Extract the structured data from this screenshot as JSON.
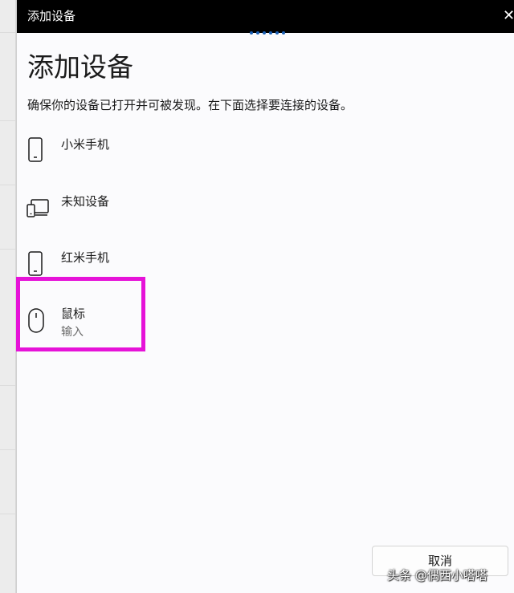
{
  "window": {
    "title": "添加设备",
    "close_icon": "✕"
  },
  "main": {
    "heading": "添加设备",
    "description": "确保你的设备已打开并可被发现。在下面选择要连接的设备。",
    "devices": [
      {
        "name": "小米手机",
        "icon": "phone-icon"
      },
      {
        "name": "未知设备",
        "icon": "devices-icon"
      },
      {
        "name": "红米手机",
        "icon": "phone-icon"
      },
      {
        "name": "鼠标",
        "subtitle": "输入",
        "icon": "mouse-icon"
      }
    ]
  },
  "footer": {
    "cancel_label": "取消"
  },
  "watermark": {
    "text": "头条 @偶西小嗒嗒"
  },
  "colors": {
    "titlebar": "#000000",
    "background": "#fbfbfd",
    "highlight": "#e612d8",
    "progress_dots": "#1a5fb4"
  }
}
